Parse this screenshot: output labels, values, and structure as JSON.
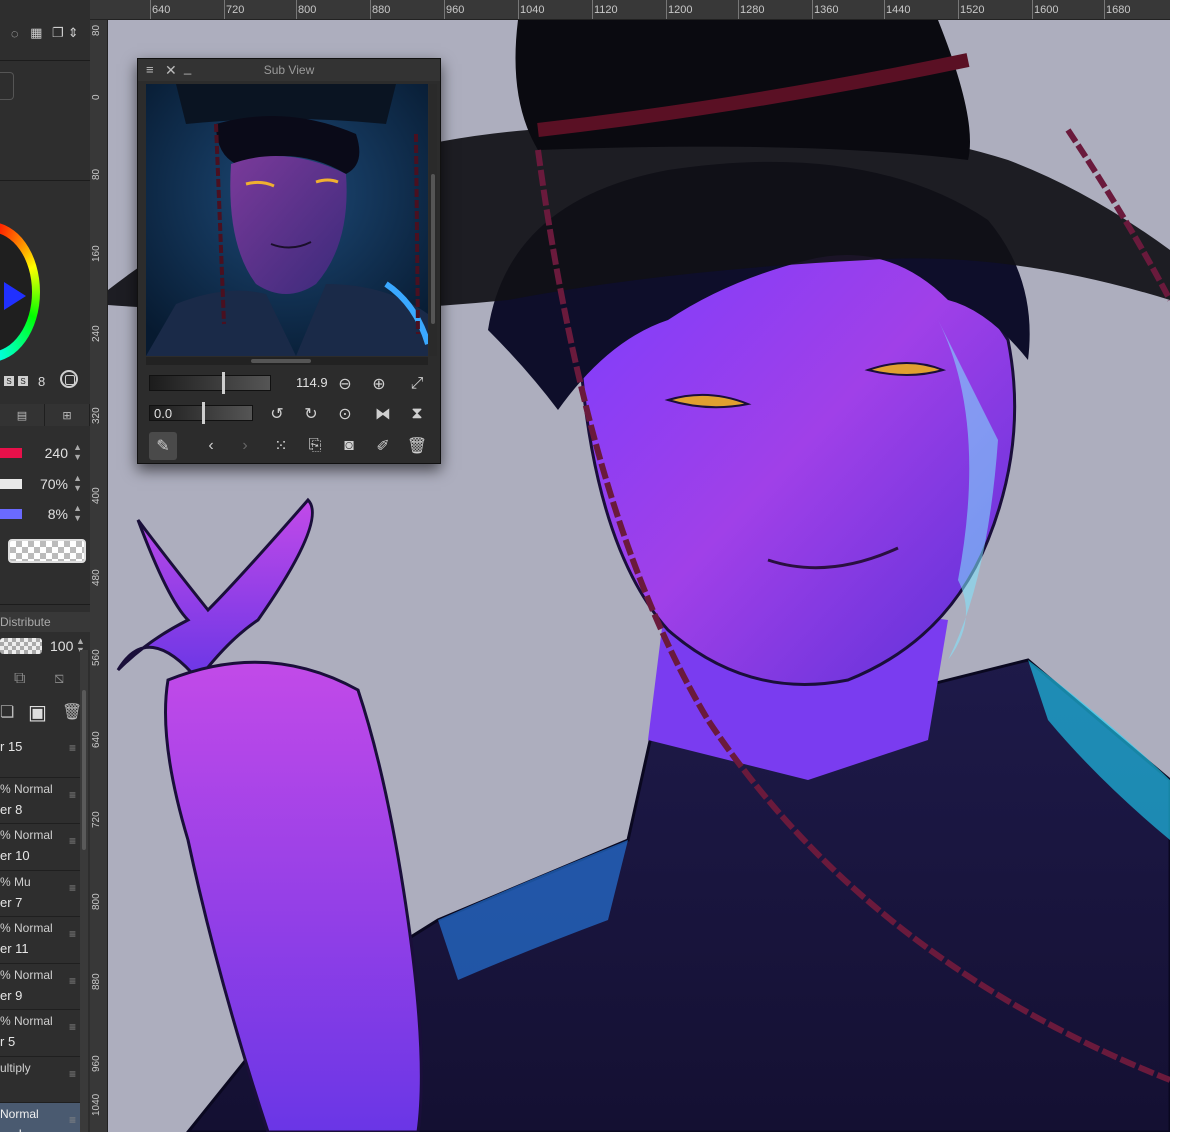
{
  "app": {
    "sub_view": {
      "title": "Sub View",
      "zoom_value": "114.9",
      "rotation_value": "0.0",
      "buttons": [
        "eyedropper-icon",
        "chevron-left-icon",
        "chevron-right-icon",
        "grid-icon",
        "import-icon",
        "camera-icon",
        "edit-icon",
        "trash-icon"
      ]
    },
    "ruler_top": {
      "labels": [
        "640",
        "720",
        "800",
        "880",
        "960",
        "1040",
        "1120",
        "1200",
        "1280",
        "1360",
        "1440",
        "1520",
        "1600",
        "1680"
      ]
    },
    "ruler_left": {
      "labels": [
        "80",
        "0",
        "80",
        "160",
        "240",
        "320",
        "400",
        "480",
        "560",
        "640",
        "720",
        "800",
        "880",
        "960",
        "1040"
      ]
    },
    "color_panel": {
      "brush_size_small": "8",
      "hue_value": "240",
      "saturation_value": "70%",
      "brightness_value": "8%",
      "hue_color": "#e8104a",
      "saturation_color": "#e8e8e8",
      "brightness_color": "#6a6aff"
    },
    "layer_panel": {
      "distribute_label": "Distribute",
      "opacity_value": "100",
      "layers": [
        {
          "mode": "",
          "name": "r 15",
          "selected": false
        },
        {
          "mode": "% Normal",
          "name": "er 8",
          "selected": false
        },
        {
          "mode": "% Normal",
          "name": "er 10",
          "selected": false
        },
        {
          "mode": "% Mu",
          "name": "er 7",
          "selected": false
        },
        {
          "mode": "% Normal",
          "name": "er 11",
          "selected": false
        },
        {
          "mode": "% Normal",
          "name": "er 9",
          "selected": false
        },
        {
          "mode": "% Normal",
          "name": "r 5",
          "selected": false
        },
        {
          "mode": "ultiply",
          "name": "",
          "selected": false
        },
        {
          "mode": "Normal",
          "name": "und",
          "selected": true
        }
      ]
    },
    "icons": {
      "close": "close-icon",
      "minimize": "minimize-icon",
      "zoom_out": "zoom-out-icon",
      "zoom_in": "zoom-in-icon",
      "fit": "fit-window-icon",
      "rotate_left": "rotate-left-icon",
      "rotate_right": "rotate-right-icon",
      "reset_rotation": "reset-rotation-icon",
      "flip_h": "flip-horizontal-icon",
      "flip_v": "flip-vertical-icon"
    }
  }
}
